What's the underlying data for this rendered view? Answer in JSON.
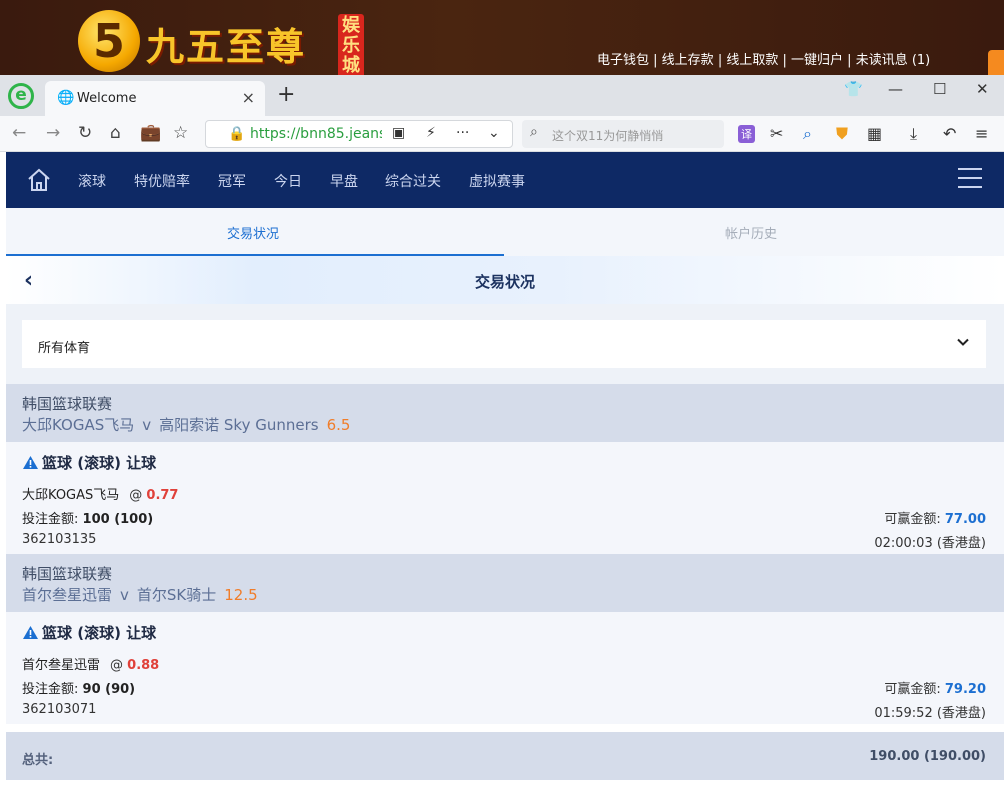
{
  "site_banner": {
    "logo_numeral": "5",
    "logo_title": "九五至尊",
    "logo_seal": "娱乐城",
    "links": [
      "电子钱包",
      "线上存款",
      "线上取款",
      "一键归户",
      "未读讯息 (1)"
    ],
    "separator": " | "
  },
  "browser": {
    "logo_letter": "e",
    "tab_title": "Welcome",
    "url": "https://bnn85.jeans",
    "search_placeholder": "这个双11为何静悄悄",
    "translate_label": "译"
  },
  "app_nav": {
    "items": [
      "滚球",
      "特优赔率",
      "冠军",
      "今日",
      "早盘",
      "综合过关",
      "虚拟赛事"
    ]
  },
  "sub_tabs": {
    "active": "交易状况",
    "inactive": "帐户历史"
  },
  "page_title": "交易状况",
  "filter": {
    "selected": "所有体育"
  },
  "bets": [
    {
      "league": "韩国篮球联赛",
      "home": "大邱KOGAS飞马",
      "away": "高阳索诺 Sky Gunners",
      "vs": "v",
      "handicap": "6.5",
      "bet_type": "篮球 (滚球) 让球",
      "selection": "大邱KOGAS飞马",
      "at": "@",
      "odds": "0.77",
      "stake_label": "投注金额:",
      "stake": "100 (100)",
      "win_label": "可赢金额:",
      "win": "77.00",
      "ticket": "362103135",
      "time": "02:00:03 (香港盘)"
    },
    {
      "league": "韩国篮球联赛",
      "home": "首尔叁星迅雷",
      "away": "首尔SK骑士",
      "vs": "v",
      "handicap": "12.5",
      "bet_type": "篮球 (滚球) 让球",
      "selection": "首尔叁星迅雷",
      "at": "@",
      "odds": "0.88",
      "stake_label": "投注金额:",
      "stake": "90 (90)",
      "win_label": "可赢金额:",
      "win": "79.20",
      "ticket": "362103071",
      "time": "01:59:52 (香港盘)"
    }
  ],
  "total": {
    "label": "总共:",
    "value": "190.00 (190.00)"
  },
  "colors": {
    "nav_bg": "#0e2965",
    "accent": "#1c6fd1",
    "odds": "#e0413a",
    "handicap": "#f07d2a"
  }
}
